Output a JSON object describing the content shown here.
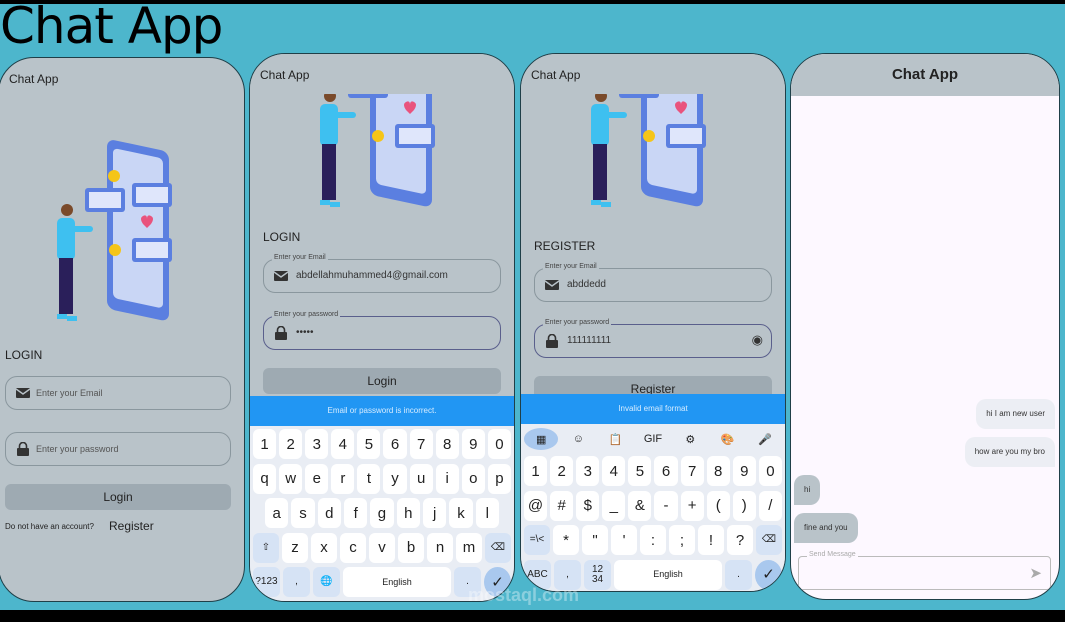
{
  "title": "Chat App",
  "app_title": "Chat App",
  "login": {
    "heading": "LOGIN",
    "email_placeholder": "Enter your Email",
    "password_placeholder": "Enter your password",
    "button": "Login",
    "no_account": "Do not have an account?",
    "register_link": "Register"
  },
  "login_filled": {
    "heading": "LOGIN",
    "email_label": "Enter your Email",
    "email_value": "abdellahmuhammed4@gmail.com",
    "password_label": "Enter your password",
    "password_value": "•••••",
    "button": "Login",
    "snackbar": "Email or password is incorrect."
  },
  "register": {
    "heading": "REGISTER",
    "email_label": "Enter your Email",
    "email_value": "abddedd",
    "password_label": "Enter your password",
    "password_value": "111111111",
    "button": "Register",
    "snackbar": "Invalid email format"
  },
  "chat": {
    "title": "Chat App",
    "messages": [
      {
        "text": "hi I am new user",
        "from": "me"
      },
      {
        "text": "how are you my bro",
        "from": "me"
      },
      {
        "text": "hi",
        "from": "them"
      },
      {
        "text": "fine and you",
        "from": "them"
      }
    ],
    "input_label": "Send Message"
  },
  "keyboard_letters": {
    "rows": [
      [
        "1",
        "2",
        "3",
        "4",
        "5",
        "6",
        "7",
        "8",
        "9",
        "0"
      ],
      [
        "q",
        "w",
        "e",
        "r",
        "t",
        "y",
        "u",
        "i",
        "o",
        "p"
      ],
      [
        "a",
        "s",
        "d",
        "f",
        "g",
        "h",
        "j",
        "k",
        "l"
      ],
      [
        "⇧",
        "z",
        "x",
        "c",
        "v",
        "b",
        "n",
        "m",
        "⌫"
      ],
      [
        "?123",
        ",",
        "🌐",
        "English",
        ".",
        "✓"
      ]
    ]
  },
  "keyboard_symbols": {
    "toolbar": [
      "grid-icon",
      "sticker-icon",
      "clipboard-icon",
      "GIF",
      "gear-icon",
      "palette-icon",
      "mic-icon"
    ],
    "toolbar_glyphs": [
      "▦",
      "☺",
      "📋",
      "GIF",
      "⚙",
      "🎨",
      "🎤"
    ],
    "rows": [
      [
        "1",
        "2",
        "3",
        "4",
        "5",
        "6",
        "7",
        "8",
        "9",
        "0"
      ],
      [
        "@",
        "#",
        "$",
        "_",
        "&",
        "-",
        "+",
        "(",
        ")",
        "/"
      ],
      [
        "=\\<",
        "*",
        "\"",
        "'",
        ":",
        ";",
        "!",
        "?",
        "⌫"
      ],
      [
        "ABC",
        ",",
        "12\n34",
        "English",
        ".",
        "✓"
      ]
    ]
  },
  "watermark": "mostaql.com",
  "colors": {
    "background": "#4db6cc",
    "snackbar": "#2196f3",
    "screen": "#b9c3c9",
    "chat_bg": "#fdf8ff"
  }
}
